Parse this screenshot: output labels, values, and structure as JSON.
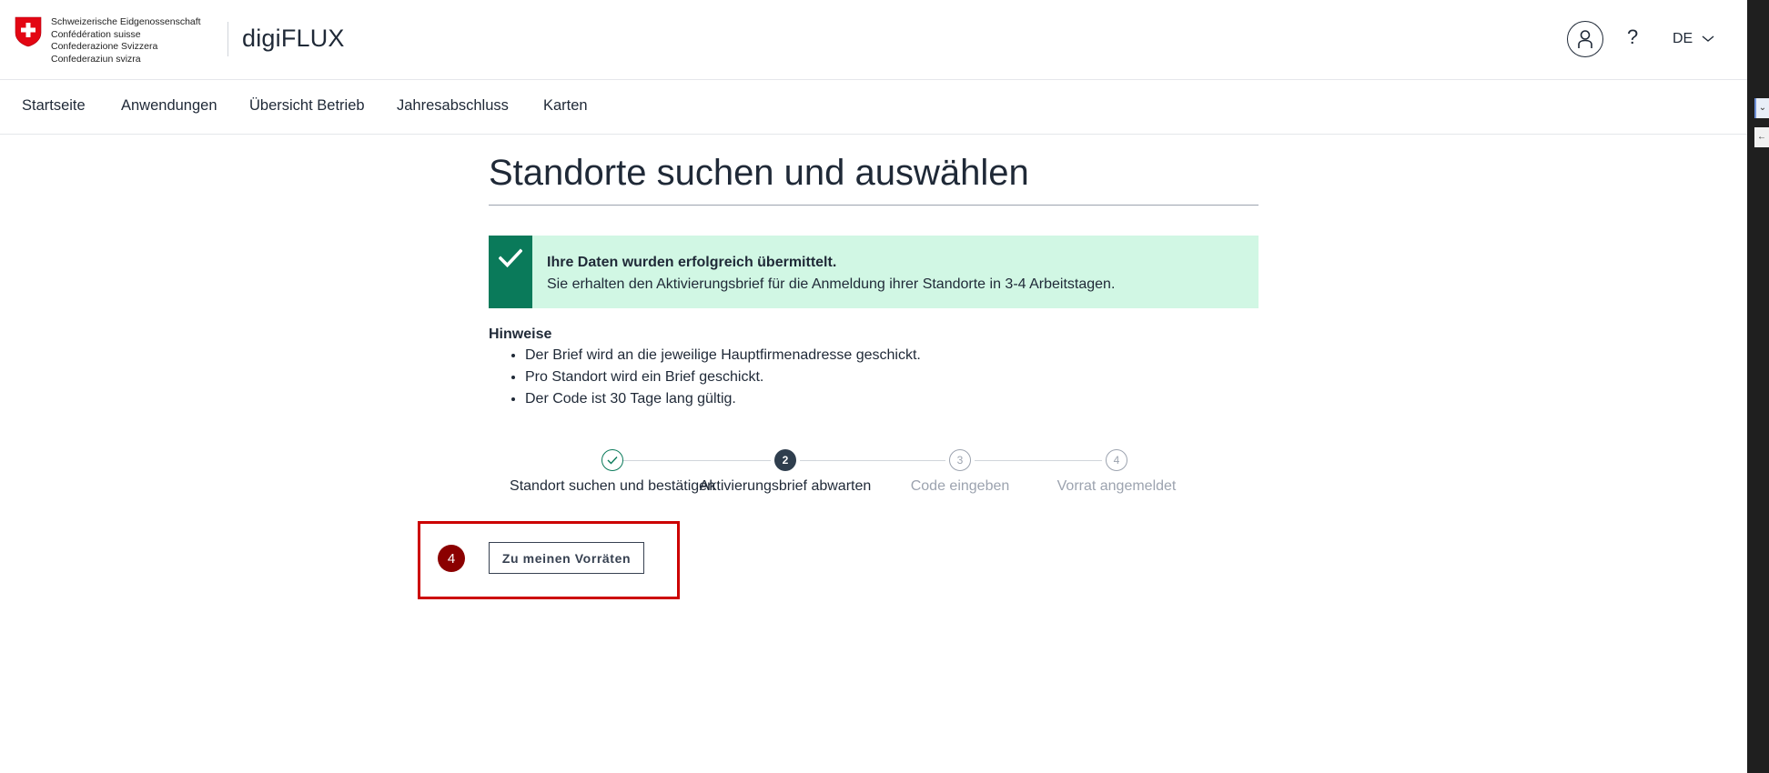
{
  "header": {
    "confederation_lines": [
      "Schweizerische Eidgenossenschaft",
      "Confédération suisse",
      "Confederazione Svizzera",
      "Confederaziun svizra"
    ],
    "app_title": "digiFLUX",
    "help_label": "?",
    "language": "DE"
  },
  "nav": {
    "items": [
      "Startseite",
      "Anwendungen",
      "Übersicht Betrieb",
      "Jahresabschluss",
      "Karten"
    ]
  },
  "main": {
    "title": "Standorte suchen und auswählen",
    "success": {
      "heading": "Ihre Daten wurden erfolgreich übermittelt.",
      "message": "Sie erhalten den Aktivierungsbrief für die Anmeldung ihrer Standorte in 3-4 Arbeitstagen."
    },
    "hints": {
      "title": "Hinweise",
      "items": [
        "Der Brief wird an die jeweilige Hauptfirmenadresse geschickt.",
        "Pro Standort wird ein Brief geschickt.",
        "Der Code ist 30 Tage lang gültig."
      ]
    },
    "stepper": {
      "steps": [
        {
          "number": "1",
          "label": "Standort suchen und bestätigen",
          "status": "completed"
        },
        {
          "number": "2",
          "label": "Aktivierungsbrief abwarten",
          "status": "current"
        },
        {
          "number": "3",
          "label": "Code eingeben",
          "status": "upcoming"
        },
        {
          "number": "4",
          "label": "Vorrat angemeldet",
          "status": "upcoming"
        }
      ]
    },
    "action_button": "Zu meinen Vorräten",
    "annotation_number": "4"
  },
  "colors": {
    "success_bg": "#d1f7e4",
    "success_accent": "#0a7a5a",
    "step_current": "#2f3e4e",
    "annotation_red": "#cc0000",
    "annotation_badge": "#8b0000"
  }
}
